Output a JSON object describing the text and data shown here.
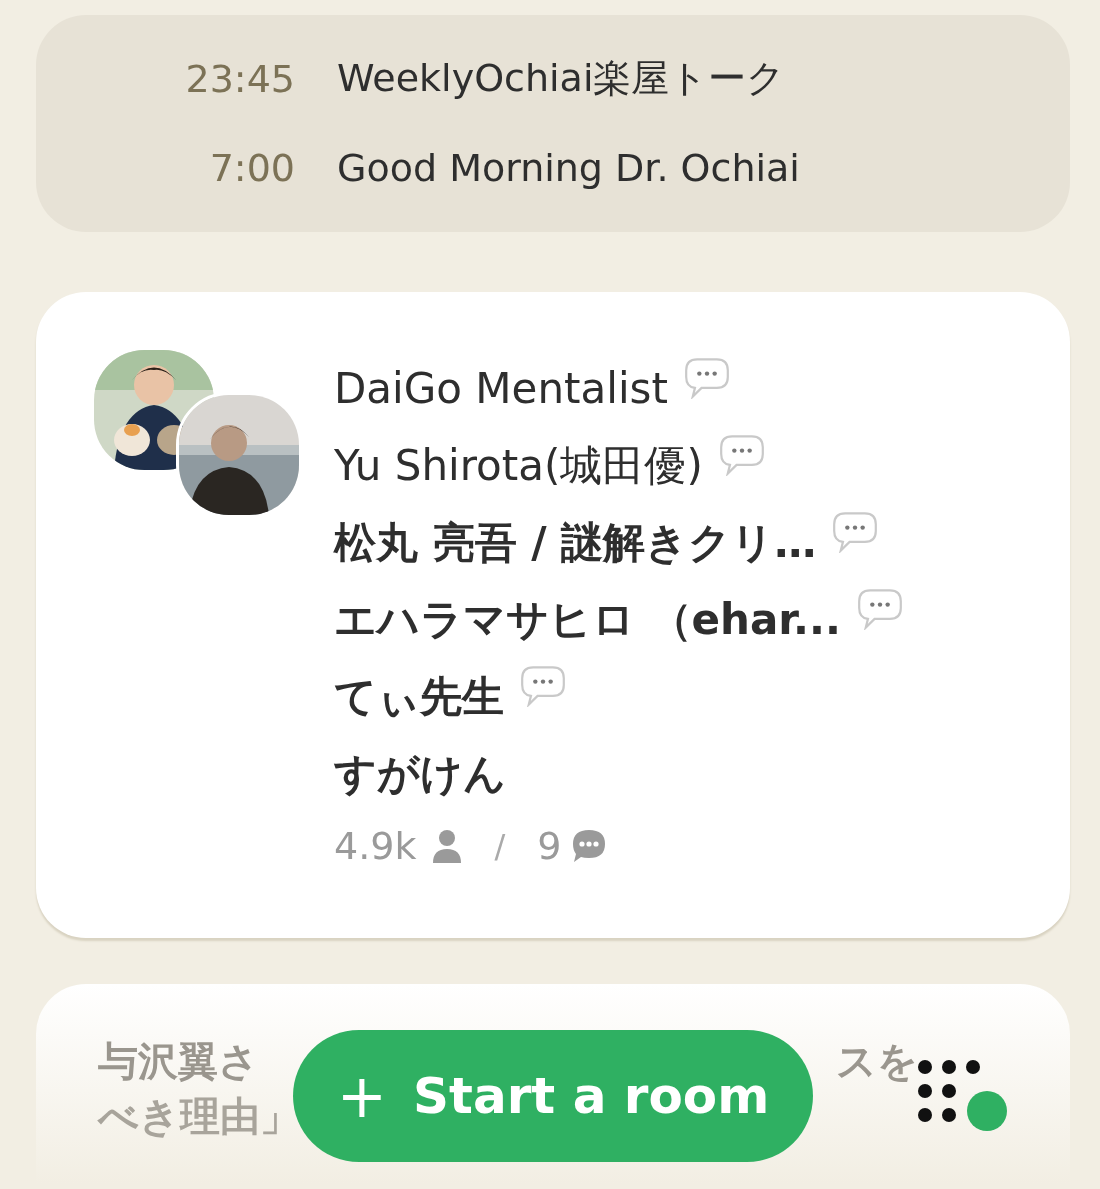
{
  "schedule": [
    {
      "time": "23:45",
      "title": "WeeklyOchiai楽屋トーク"
    },
    {
      "time": "7:00",
      "title": "Good Morning Dr. Ochiai"
    }
  ],
  "room": {
    "speakers": [
      {
        "name": "DaiGo Mentalist",
        "speaker": true
      },
      {
        "name": "Yu Shirota(城田優)",
        "speaker": true
      },
      {
        "name": "松丸 亮吾 / 謎解きクリ…",
        "speaker": true
      },
      {
        "name": "エハラマサヒロ （ehar...",
        "speaker": true
      },
      {
        "name": "てぃ先生",
        "speaker": true
      },
      {
        "name": "すがけん",
        "speaker": false
      }
    ],
    "listeners": "4.9k",
    "separator": "/",
    "speaker_count": "9"
  },
  "next_room": {
    "lines": [
      [
        "与沢翼さ",
        "スを"
      ],
      [
        "べき理由」"
      ]
    ]
  },
  "start_button": {
    "icon": "+",
    "label": "Start a room"
  }
}
